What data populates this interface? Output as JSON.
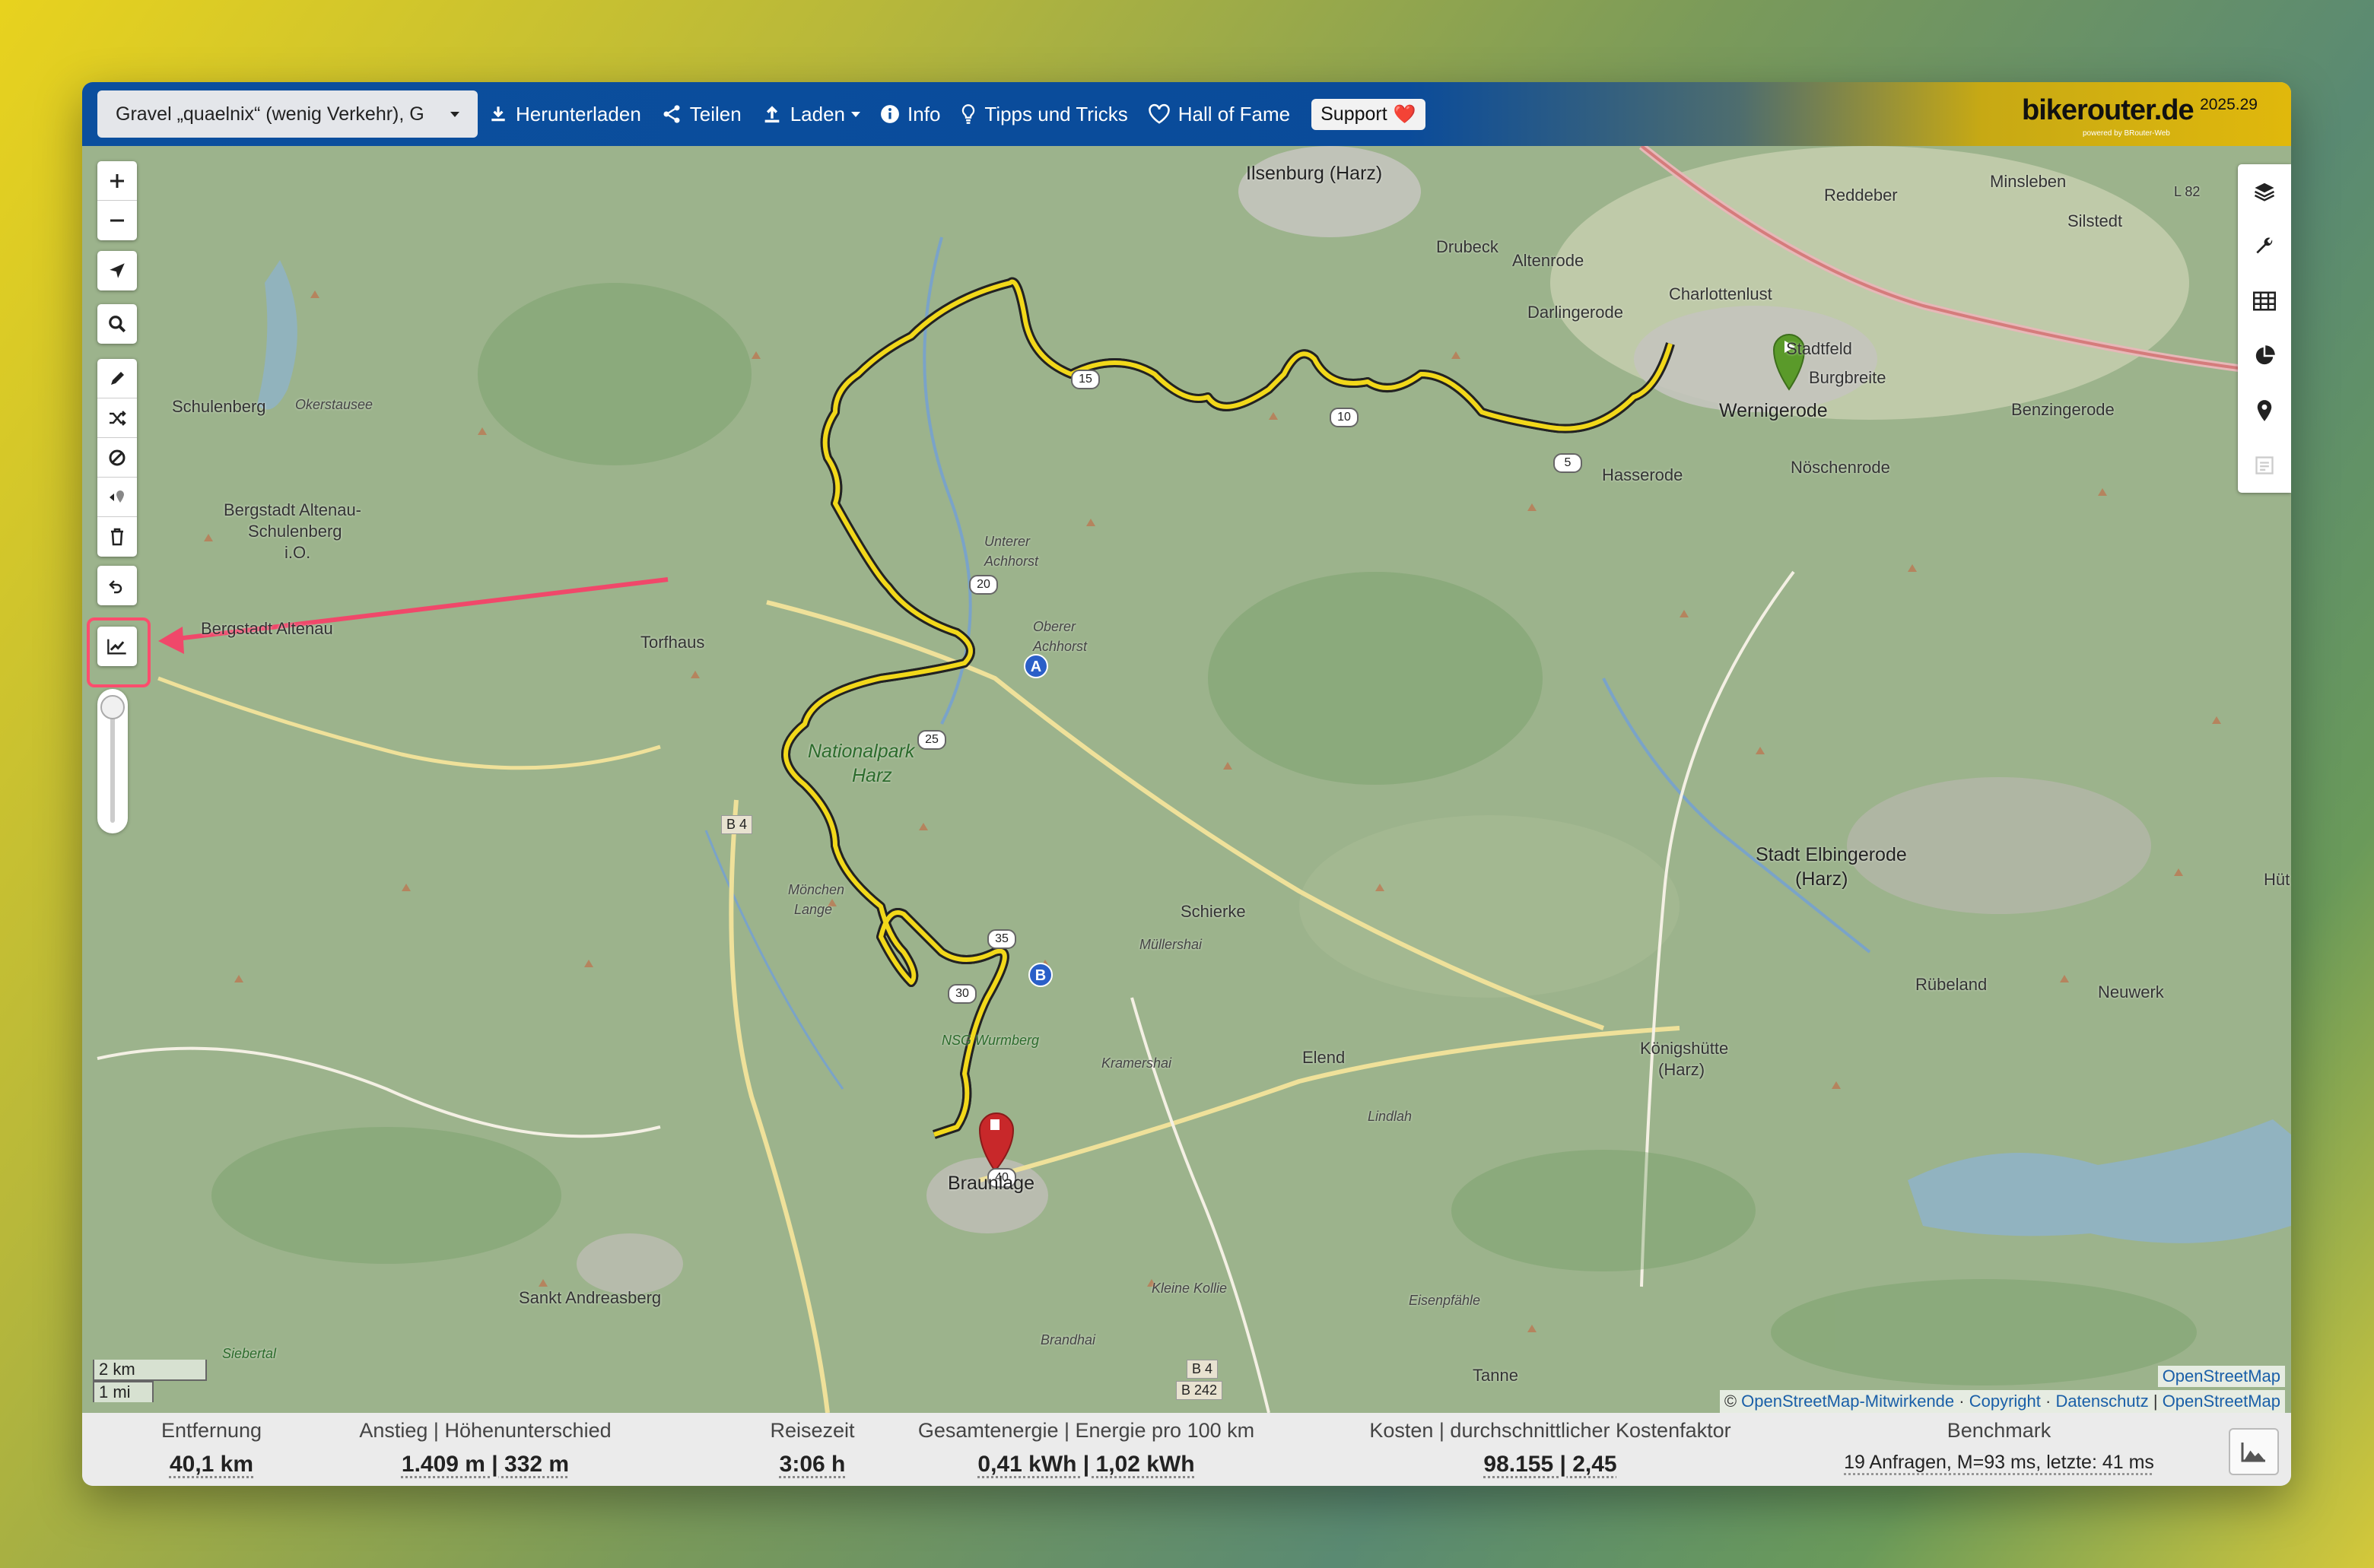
{
  "app": {
    "brand": "bikerouter.de",
    "brand_sub": "powered by BRouter-Web",
    "version": "2025.29"
  },
  "navbar": {
    "profile": "Gravel „quaelnix“ (wenig Verkehr), G",
    "download": "Herunterladen",
    "share": "Teilen",
    "load": "Laden",
    "info": "Info",
    "tips": "Tipps und Tricks",
    "hall_of_fame": "Hall of Fame",
    "support": "Support",
    "support_heart": "❤️"
  },
  "map": {
    "places": {
      "ilsenburg": "Ilsenburg (Harz)",
      "reddeber": "Reddeber",
      "minsleben": "Minsleben",
      "silstedt": "Silstedt",
      "drubeck": "Drubeck",
      "altenrode": "Altenrode",
      "charlottenlust": "Charlottenlust",
      "darlingerode": "Darlingerode",
      "stadtfeld": "Stadtfeld",
      "burgbreite": "Burgbreite",
      "wernigerode": "Wernigerode",
      "benzingerode": "Benzingerode",
      "hasserode": "Hasserode",
      "noeschenrode": "Nöschenrode",
      "schulenberg": "Schulenberg",
      "okerstausee": "Okerstausee",
      "altenau_1": "Bergstadt Altenau-",
      "altenau_2": "Schulenberg",
      "altenau_3": "i.O.",
      "bergstadt_altenau": "Bergstadt Altenau",
      "torfhaus": "Torfhaus",
      "np_1": "Nationalpark",
      "np_2": "Harz",
      "moenchen": "Mönchen",
      "lange": "Lange",
      "schierke": "Schierke",
      "muellershai": "Müllershai",
      "elbingerode_1": "Stadt Elbingerode",
      "elbingerode_2": "(Harz)",
      "ruebeland": "Rübeland",
      "neuwerk": "Neuwerk",
      "koenigshuette_1": "Königshütte",
      "koenigshuette_2": "(Harz)",
      "elend": "Elend",
      "kramershai": "Kramershai",
      "lindlah": "Lindlah",
      "nsg": "NSG Wurmberg",
      "braunlage": "Braunlage",
      "andreasberg": "Sankt Andreasberg",
      "siebertal": "Siebertal",
      "kleine_kollie": "Kleine Kollie",
      "brandhai": "Brandhai",
      "eisenpfahle": "Eisenpfähle",
      "tanne": "Tanne",
      "hut": "Hüt",
      "l82": "L 82",
      "b4": "B 4",
      "b4b": "B 4",
      "b242": "B 242",
      "unterer": "Unterer",
      "achhorst": "Achhorst",
      "oberer": "Oberer",
      "achhorst2": "Achhorst"
    },
    "km_markers": [
      "5",
      "10",
      "15",
      "20",
      "25",
      "30",
      "35",
      "40"
    ],
    "waypoints": [
      "A",
      "B"
    ],
    "scale_km": "2 km",
    "scale_mi": "1 mi",
    "attribution_top": "OpenStreetMap",
    "attribution_prefix": "© ",
    "attribution_osm": "OpenStreetMap-Mitwirkende",
    "attribution_copyright": "Copyright",
    "attribution_privacy": "Datenschutz",
    "attribution_layer": "OpenStreetMap",
    "sep_dot": " · ",
    "sep_bar": " | "
  },
  "stats": {
    "distance_label": "Entfernung",
    "distance_value": "40,1 km",
    "ascent_label": "Anstieg | Höhenunterschied",
    "ascent_value": "1.409 m | 332 m",
    "time_label": "Reisezeit",
    "time_value": "3:06 h",
    "energy_label": "Gesamtenergie | Energie pro 100 km",
    "energy_value": "0,41 kWh | 1,02 kWh",
    "cost_label": "Kosten | durchschnittlicher Kostenfaktor",
    "cost_value": "98.155 | 2,45",
    "bench_label": "Benchmark",
    "bench_value": "19 Anfragen, M=93 ms, letzte: 41 ms"
  },
  "colors": {
    "navbar_blue": "#0b4f9e",
    "route_yellow": "#f2d81a",
    "highlight": "#ff4d6d",
    "start_marker": "#5a9a2a",
    "end_marker": "#c8282a"
  },
  "icons": [
    "download-icon",
    "share-icon",
    "upload-icon",
    "info-icon",
    "lightbulb-icon",
    "heart-icon",
    "zoom-in-icon",
    "zoom-out-icon",
    "locate-icon",
    "search-icon",
    "pencil-icon",
    "shuffle-icon",
    "no-entry-icon",
    "poi-icon",
    "trash-icon",
    "undo-icon",
    "elevation-chart-icon",
    "layers-icon",
    "wrench-icon",
    "table-icon",
    "pie-icon",
    "pin-icon",
    "export-icon",
    "mountain-chart-icon"
  ]
}
